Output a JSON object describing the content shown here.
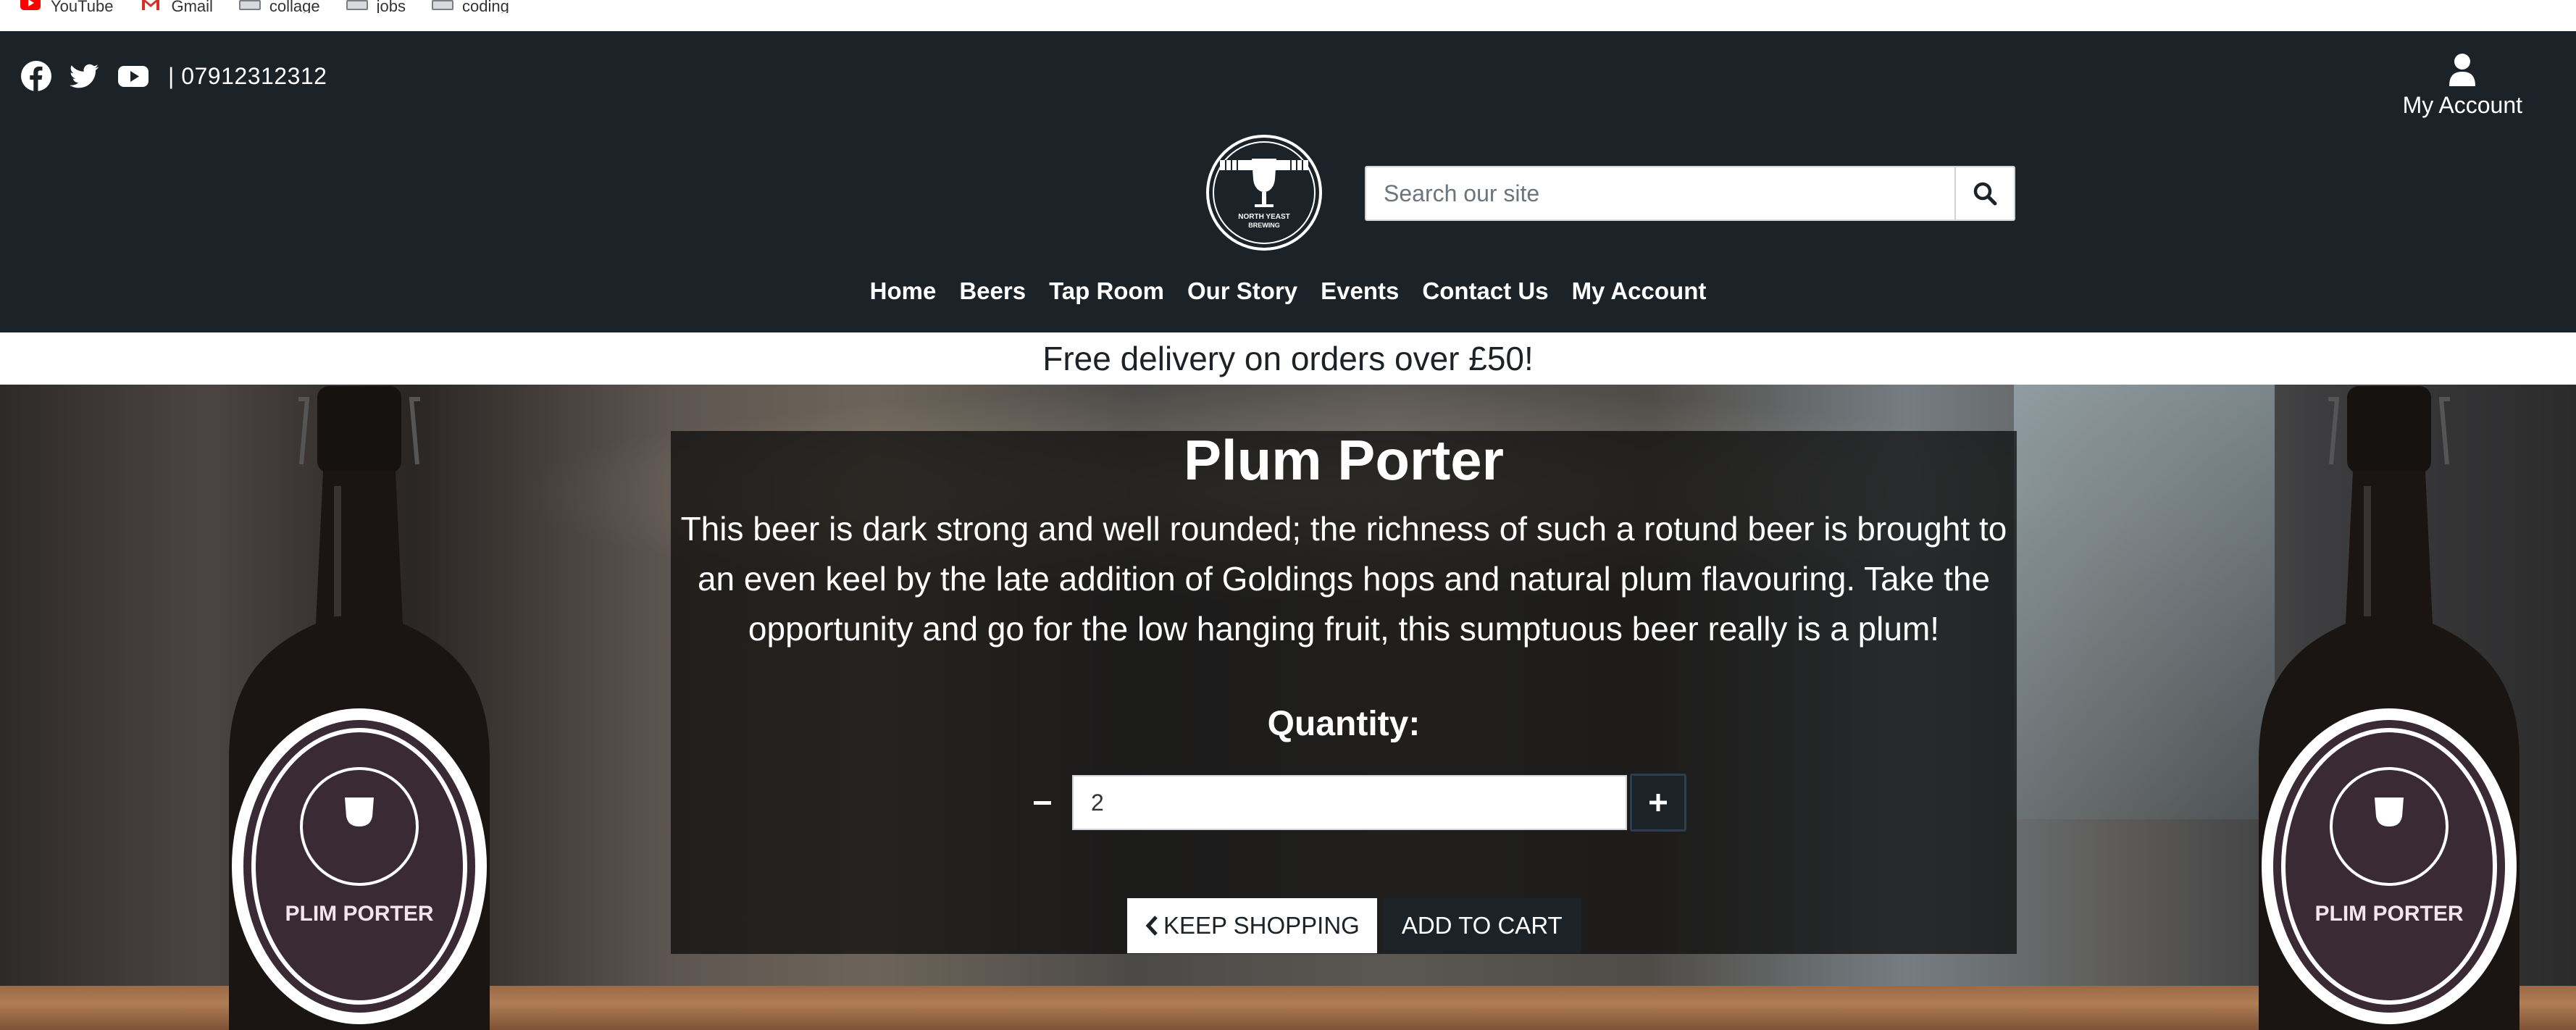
{
  "bookmarks": [
    {
      "label": "YouTube",
      "icon": "youtube-icon"
    },
    {
      "label": "Gmail",
      "icon": "gmail-icon"
    },
    {
      "label": "collage",
      "icon": "folder-icon"
    },
    {
      "label": "jobs",
      "icon": "folder-icon"
    },
    {
      "label": "coding",
      "icon": "folder-icon"
    }
  ],
  "header": {
    "phone": "| 07912312312",
    "account_label": "My Account",
    "search_placeholder": "Search our site",
    "social_icons": [
      "facebook-icon",
      "twitter-icon",
      "youtube-icon"
    ]
  },
  "nav": {
    "items": [
      "Home",
      "Beers",
      "Tap Room",
      "Our Story",
      "Events",
      "Contact Us",
      "My Account"
    ]
  },
  "banner": {
    "text": "Free delivery on orders over £50!"
  },
  "product": {
    "title": "Plum Porter",
    "description": "This beer is dark strong and well rounded; the richness of such a rotund beer is brought to an even keel by the late addition of Goldings hops and natural plum flavouring. Take the opportunity and go for the low hanging fruit, this sumptuous beer really is a plum!",
    "quantity_label": "Quantity:",
    "quantity_value": "2",
    "bottle_label": "PLIM PORTER",
    "logo_text": "NORTH YEAST BREWING"
  },
  "actions": {
    "keep_shopping": "KEEP SHOPPING",
    "add_to_cart": "ADD TO CART"
  },
  "colors": {
    "header_bg": "#1b2329",
    "banner_bg": "#ffffff",
    "accent_border": "#2c3e50"
  }
}
